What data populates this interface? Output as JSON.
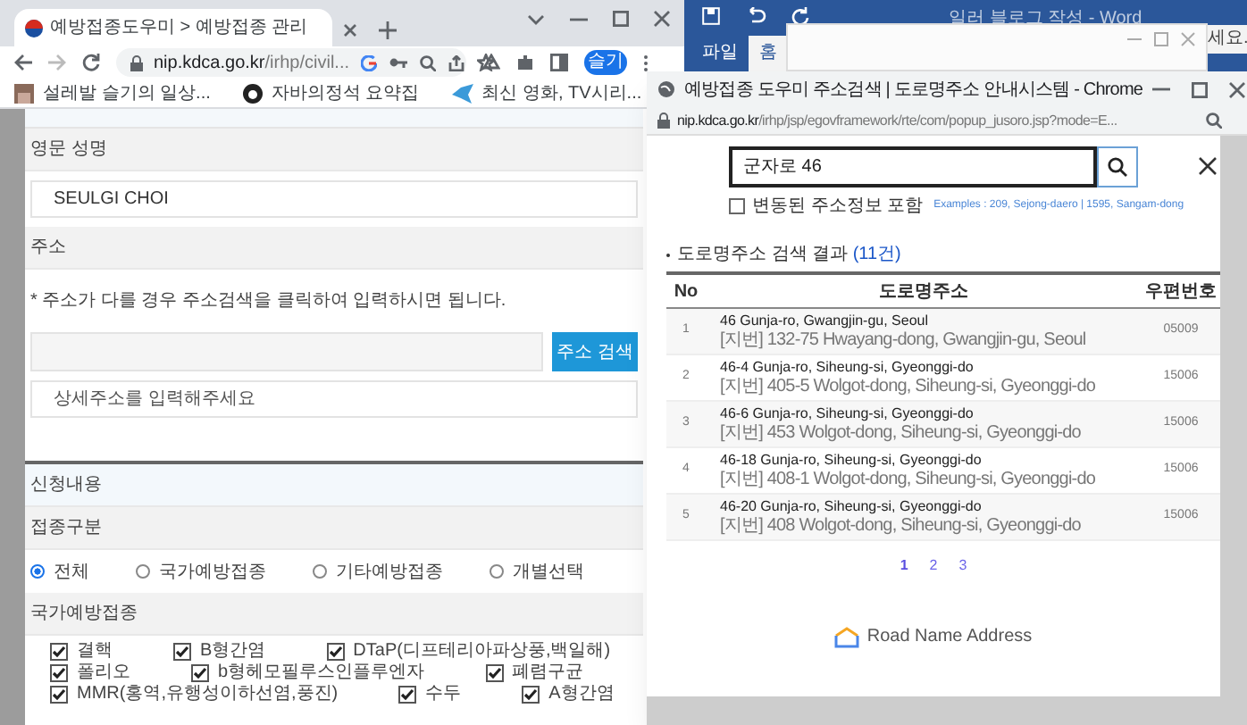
{
  "main_browser": {
    "tab_title": "예방접종도우미 > 예방접종 관리",
    "url_host": "nip.kdca.go.kr",
    "url_path": "/irhp/civil...",
    "profile": "슬기",
    "bookmarks": [
      {
        "kind": "image",
        "label": "설레발 슬기의 일상..."
      },
      {
        "kind": "github",
        "label": "자바의정석 요약집"
      },
      {
        "kind": "bird",
        "label": "최신 영화, TV시리..."
      }
    ]
  },
  "form": {
    "english_name_label": "영문 성명",
    "english_name_value": "SEULGI CHOI",
    "address_label": "주소",
    "address_note": "* 주소가 다를 경우 주소검색을 클릭하여 입력하시면 됩니다.",
    "address_button": "주소 검색",
    "detail_placeholder": "상세주소를 입력해주세요",
    "section_title": "신청내용",
    "type_label": "접종구분",
    "types": [
      {
        "label": "전체",
        "selected": true
      },
      {
        "label": "국가예방접종",
        "selected": false
      },
      {
        "label": "기타예방접종",
        "selected": false
      },
      {
        "label": "개별선택",
        "selected": false
      }
    ],
    "national_label": "국가예방접종",
    "vaccine_rows": [
      [
        {
          "label": "결핵",
          "checked": true
        },
        {
          "label": "B형간염",
          "checked": true
        },
        {
          "label": "DTaP(디프테리아파상풍,백일해)",
          "checked": true
        }
      ],
      [
        {
          "label": "폴리오",
          "checked": true
        },
        {
          "label": "b형헤모필루스인플루엔자",
          "checked": true
        },
        {
          "label": "폐렴구균",
          "checked": true
        }
      ],
      [
        {
          "label": "MMR(홍역,유행성이하선염,풍진)",
          "checked": true
        },
        {
          "label": "수두",
          "checked": true
        },
        {
          "label": "A형간염",
          "checked": true
        }
      ]
    ]
  },
  "word": {
    "title": "일러 블로그 작성 - Word",
    "tabs": [
      {
        "label": "파일",
        "selected": false
      },
      {
        "label": "홈",
        "selected": true
      }
    ],
    "ribbon_text": "세요."
  },
  "popup": {
    "title": "예방접종 도우미 주소검색 | 도로명주소 안내시스템 - Chrome",
    "url_host": "nip.kdca.go.kr",
    "url_path": "/irhp/jsp/egovframework/rte/com/popup_jusoro.jsp?mode=E...",
    "search_value": "군자로 46",
    "include_changed": {
      "label": "변동된 주소정보 포함",
      "checked": false
    },
    "examples": "Examples : 209, Sejong-daero | 1595, Sangam-dong",
    "result_label": "도로명주소 검색 결과",
    "result_count": "(11건)",
    "columns": [
      "No",
      "도로명주소",
      "우편번호"
    ],
    "rows": [
      {
        "no": "1",
        "road": "46 Gunja-ro, Gwangjin-gu, Seoul",
        "jibun": "[지번] 132-75 Hwayang-dong, Gwangjin-gu, Seoul",
        "zip": "05009"
      },
      {
        "no": "2",
        "road": "46-4 Gunja-ro, Siheung-si, Gyeonggi-do",
        "jibun": "[지번] 405-5 Wolgot-dong, Siheung-si, Gyeonggi-do",
        "zip": "15006"
      },
      {
        "no": "3",
        "road": "46-6 Gunja-ro, Siheung-si, Gyeonggi-do",
        "jibun": "[지번] 453 Wolgot-dong, Siheung-si, Gyeonggi-do",
        "zip": "15006"
      },
      {
        "no": "4",
        "road": "46-18 Gunja-ro, Siheung-si, Gyeonggi-do",
        "jibun": "[지번] 408-1 Wolgot-dong, Siheung-si, Gyeonggi-do",
        "zip": "15006"
      },
      {
        "no": "5",
        "road": "46-20 Gunja-ro, Siheung-si, Gyeonggi-do",
        "jibun": "[지번] 408 Wolgot-dong, Siheung-si, Gyeonggi-do",
        "zip": "15006"
      }
    ],
    "pages": [
      {
        "label": "1",
        "selected": true
      },
      {
        "label": "2",
        "selected": false
      },
      {
        "label": "3",
        "selected": false
      }
    ],
    "logo_text": "Road Name Address"
  }
}
